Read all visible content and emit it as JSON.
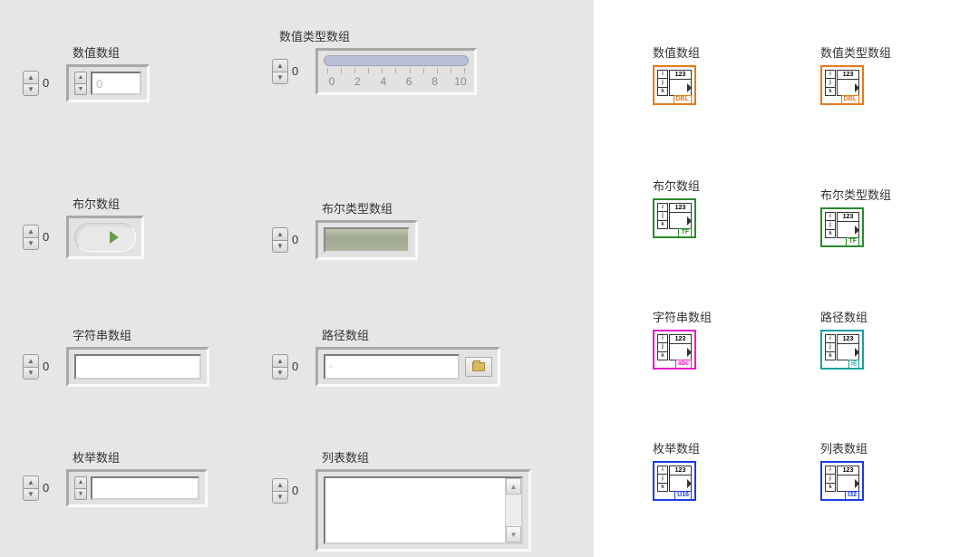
{
  "front_panel": {
    "numeric_array": {
      "label": "数值数组",
      "index": "0",
      "value": "0"
    },
    "numeric_type_array": {
      "label": "数值类型数组",
      "index": "0",
      "scale": [
        "0",
        "2",
        "4",
        "6",
        "8",
        "10"
      ]
    },
    "bool_array": {
      "label": "布尔数组",
      "index": "0"
    },
    "bool_type_array": {
      "label": "布尔类型数组",
      "index": "0"
    },
    "string_array": {
      "label": "字符串数组",
      "index": "0"
    },
    "path_array": {
      "label": "路径数组",
      "index": "0",
      "placeholder": "▫"
    },
    "enum_array": {
      "label": "枚举数组",
      "index": "0"
    },
    "list_array": {
      "label": "列表数组",
      "index": "0"
    }
  },
  "block_diagram": {
    "numeric_array": {
      "label": "数值数组",
      "tag": "DBL",
      "color": "orange"
    },
    "numeric_type_array": {
      "label": "数值类型数组",
      "tag": "DBL",
      "color": "orange"
    },
    "bool_array": {
      "label": "布尔数组",
      "tag": "TF",
      "color": "green"
    },
    "bool_type_array": {
      "label": "布尔类型数组",
      "tag": "TF",
      "color": "green"
    },
    "string_array": {
      "label": "字符串数组",
      "tag": "abc",
      "color": "magenta"
    },
    "path_array": {
      "label": "路径数组",
      "tag": "⎘",
      "color": "teal"
    },
    "enum_array": {
      "label": "枚举数组",
      "tag": "U16",
      "color": "blue"
    },
    "list_array": {
      "label": "列表数组",
      "tag": "I32",
      "color": "blue"
    }
  },
  "icon_ijk": "i j k",
  "icon_123": "123"
}
